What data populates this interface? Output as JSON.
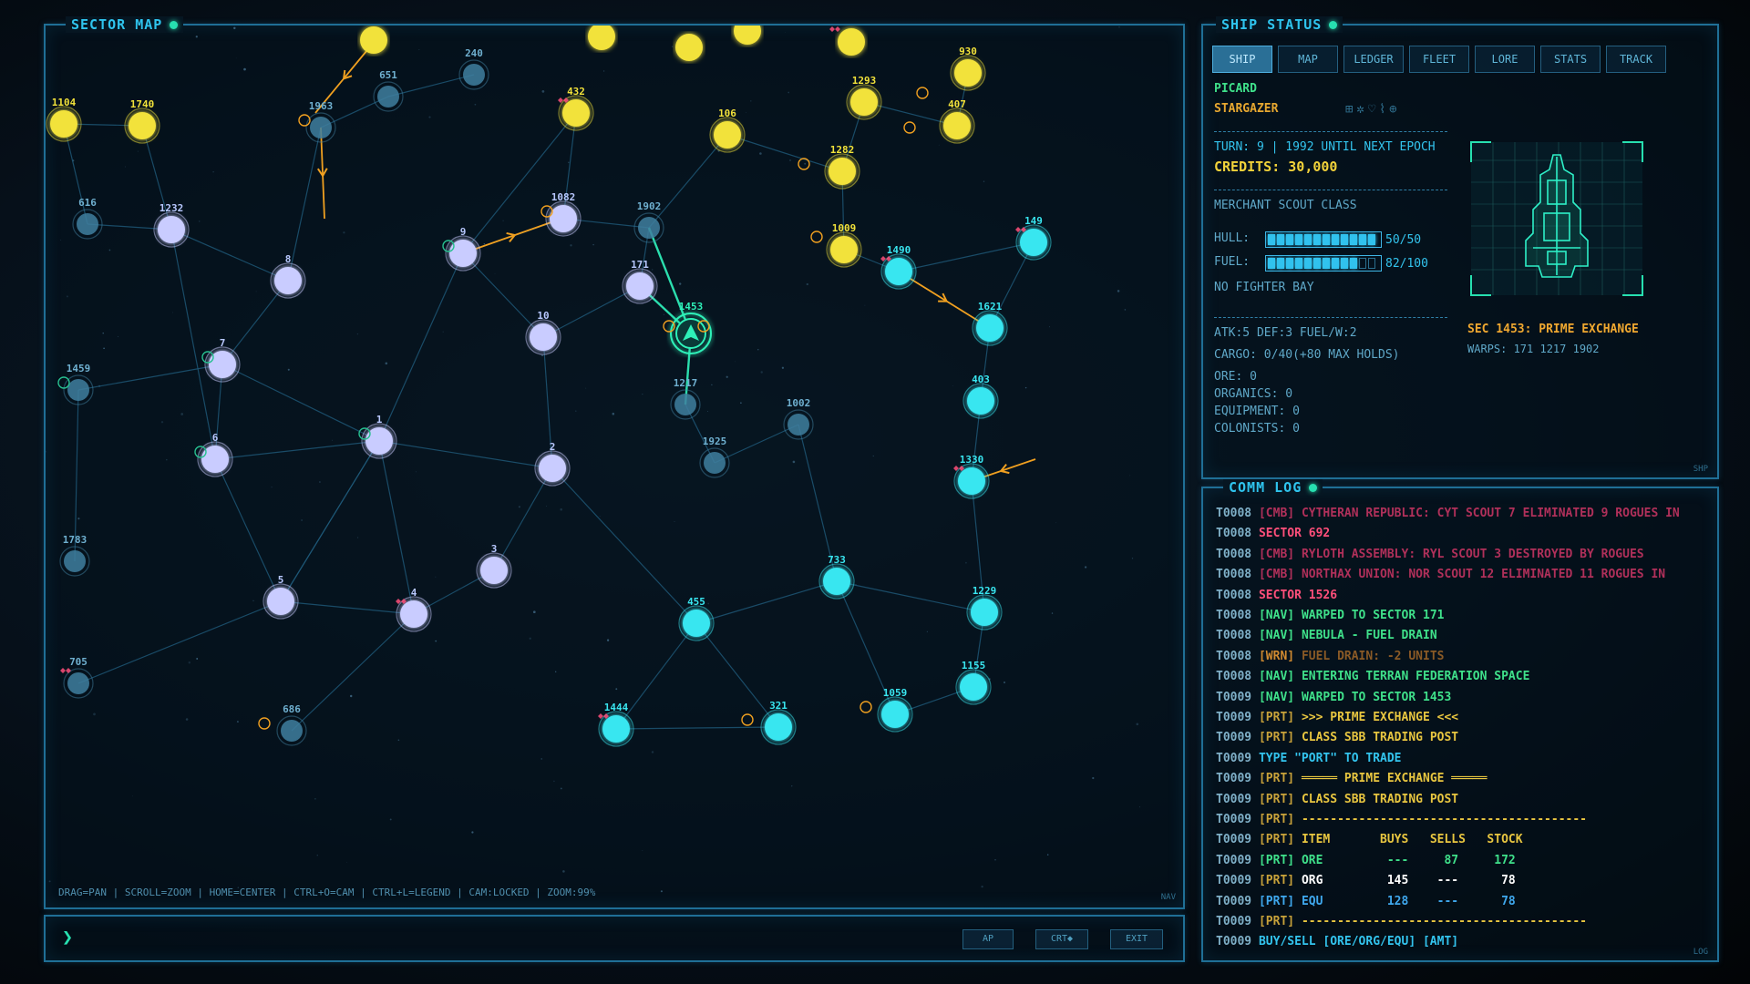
{
  "sector_map": {
    "title": "SECTOR MAP",
    "help": "DRAG=PAN | SCROLL=ZOOM | HOME=CENTER | CTRL+O=CAM | CTRL+L=LEGEND | CAM:LOCKED | ZOOM:99%",
    "corner": "NAV"
  },
  "command_bar": {
    "prompt": "❯",
    "buttons": [
      "AP",
      "CRT◆",
      "EXIT"
    ]
  },
  "ship_status": {
    "title": "SHIP STATUS",
    "tabs": [
      "SHIP",
      "MAP",
      "LEDGER",
      "FLEET",
      "LORE",
      "STATS",
      "TRACK"
    ],
    "active_tab": "SHIP",
    "captain": "PICARD",
    "ship_name": "STARGAZER",
    "turn_line": "TURN: 9 | 1992 UNTIL NEXT EPOCH",
    "credits": "CREDITS: 30,000",
    "ship_class": "MERCHANT SCOUT CLASS",
    "hull_label": "HULL:",
    "hull_value": "50/50",
    "hull_fraction": 1.0,
    "fuel_label": "FUEL:",
    "fuel_value": "82/100",
    "fuel_fraction": 0.82,
    "fighter_bay": "NO FIGHTER BAY",
    "stats_line": "ATK:5 DEF:3 FUEL/W:2",
    "cargo_line": "CARGO: 0/40(+80 MAX HOLDS)",
    "ore": "ORE: 0",
    "organics": "ORGANICS: 0",
    "equipment": "EQUIPMENT: 0",
    "colonists": "COLONISTS: 0",
    "sector_line": "SEC 1453: PRIME EXCHANGE",
    "warps_line": "WARPS: 171 1217 1902",
    "corner": "SHP"
  },
  "comm_log": {
    "title": "COMM LOG",
    "corner": "LOG",
    "lines": [
      {
        "t": "T0008",
        "parts": [
          [
            "[CMB] ",
            "#b0305a"
          ],
          [
            "CYTHERAN REPUBLIC: CYT SCOUT 7 ELIMINATED 9 ROGUES IN",
            "#b0305a"
          ]
        ]
      },
      {
        "t": "T0008",
        "parts": [
          [
            "SECTOR 692",
            "#ff4f7a"
          ]
        ]
      },
      {
        "t": "T0008",
        "parts": [
          [
            "[CMB] ",
            "#b0305a"
          ],
          [
            "RYLOTH ASSEMBLY: RYL SCOUT 3 DESTROYED BY ROGUES",
            "#b0305a"
          ]
        ]
      },
      {
        "t": "T0008",
        "parts": [
          [
            "[CMB] ",
            "#b0305a"
          ],
          [
            "NORTHAX UNION: NOR SCOUT 12 ELIMINATED 11 ROGUES IN",
            "#b0305a"
          ]
        ]
      },
      {
        "t": "T0008",
        "parts": [
          [
            "SECTOR 1526",
            "#ff4f7a"
          ]
        ]
      },
      {
        "t": "T0008",
        "parts": [
          [
            "[NAV] ",
            "#3fe08a"
          ],
          [
            "WARPED TO SECTOR 171",
            "#3fe08a"
          ]
        ]
      },
      {
        "t": "T0008",
        "parts": [
          [
            "[NAV] ",
            "#3fe08a"
          ],
          [
            "NEBULA - FUEL DRAIN",
            "#3fe08a"
          ]
        ]
      },
      {
        "t": "T0008",
        "parts": [
          [
            "[WRN] ",
            "#d08a30"
          ],
          [
            "FUEL DRAIN: -2 UNITS",
            "#8a5a26"
          ]
        ]
      },
      {
        "t": "T0008",
        "parts": [
          [
            "[NAV] ",
            "#3fe08a"
          ],
          [
            "ENTERING TERRAN FEDERATION SPACE",
            "#3fe08a"
          ]
        ]
      },
      {
        "t": "T0009",
        "parts": [
          [
            "[NAV] ",
            "#3fe08a"
          ],
          [
            "WARPED TO SECTOR 1453",
            "#3fe08a"
          ]
        ]
      },
      {
        "t": "T0009",
        "parts": [
          [
            "[PRT] ",
            "#c8a23a"
          ],
          [
            ">>> PRIME EXCHANGE <<<",
            "#e8c640"
          ]
        ]
      },
      {
        "t": "T0009",
        "parts": [
          [
            "[PRT] ",
            "#c8a23a"
          ],
          [
            "CLASS SBB TRADING POST",
            "#e8c640"
          ]
        ]
      },
      {
        "t": "T0009",
        "parts": [
          [
            "TYPE \"PORT\" TO TRADE",
            "#33c4ee"
          ]
        ]
      },
      {
        "t": "T0009",
        "parts": [
          [
            "[PRT] ",
            "#c8a23a"
          ],
          [
            "═════ PRIME EXCHANGE ═════",
            "#e8c640"
          ]
        ]
      },
      {
        "t": "T0009",
        "parts": [
          [
            "[PRT] ",
            "#c8a23a"
          ],
          [
            "CLASS SBB TRADING POST",
            "#e8c640"
          ]
        ]
      },
      {
        "t": "T0009",
        "parts": [
          [
            "[PRT] ",
            "#c8a23a"
          ],
          [
            "----------------------------------------",
            "#e8c640"
          ]
        ]
      },
      {
        "t": "T0009",
        "parts": [
          [
            "[PRT] ",
            "#c8a23a"
          ],
          [
            "ITEM       BUYS   SELLS   STOCK",
            "#e8c640"
          ]
        ]
      },
      {
        "t": "T0009",
        "parts": [
          [
            "[PRT] ",
            "#3fe08a"
          ],
          [
            "ORE         ---     87     172",
            "#3fe08a"
          ]
        ]
      },
      {
        "t": "T0009",
        "parts": [
          [
            "[PRT] ",
            "#c8a23a"
          ],
          [
            "ORG         145    ---      78",
            "#ffffff"
          ]
        ]
      },
      {
        "t": "T0009",
        "parts": [
          [
            "[PRT] ",
            "#3fa8ee"
          ],
          [
            "EQU         128    ---      78",
            "#3fa8ee"
          ]
        ]
      },
      {
        "t": "T0009",
        "parts": [
          [
            "[PRT] ",
            "#c8a23a"
          ],
          [
            "----------------------------------------",
            "#e8c640"
          ]
        ]
      },
      {
        "t": "T0009",
        "parts": [
          [
            "BUY/SELL [ORE/ORG/EQU] [AMT]",
            "#33c4ee"
          ]
        ]
      }
    ]
  },
  "colors": {
    "yellow": "#f2e23a",
    "lavender": "#c9ccff",
    "cyan": "#39e6f0",
    "steel": "#3f7f9f",
    "route": "#f0a020",
    "player": "#2ef0b8"
  },
  "nodes": [
    {
      "id": "240",
      "c": "steel"
    },
    {
      "id": "651",
      "c": "steel"
    },
    {
      "id": "1963",
      "c": "steel"
    },
    {
      "id": "1104",
      "c": "yellow"
    },
    {
      "id": "1740",
      "c": "yellow"
    },
    {
      "id": "616",
      "c": "steel"
    },
    {
      "id": "1232",
      "c": "lavender"
    },
    {
      "id": "8",
      "c": "lavender"
    },
    {
      "id": "9",
      "c": "lavender"
    },
    {
      "id": "1082",
      "c": "lavender"
    },
    {
      "id": "432",
      "c": "yellow"
    },
    {
      "id": "106",
      "c": "yellow"
    },
    {
      "id": "1902",
      "c": "steel"
    },
    {
      "id": "171",
      "c": "lavender"
    },
    {
      "id": "1453",
      "c": "player"
    },
    {
      "id": "10",
      "c": "lavender"
    },
    {
      "id": "1217",
      "c": "steel"
    },
    {
      "id": "1002",
      "c": "steel"
    },
    {
      "id": "1925",
      "c": "steel"
    },
    {
      "id": "7",
      "c": "lavender"
    },
    {
      "id": "1459",
      "c": "steel"
    },
    {
      "id": "6",
      "c": "lavender"
    },
    {
      "id": "1",
      "c": "lavender"
    },
    {
      "id": "2",
      "c": "lavender"
    },
    {
      "id": "1783",
      "c": "steel"
    },
    {
      "id": "3",
      "c": "lavender"
    },
    {
      "id": "5",
      "c": "lavender"
    },
    {
      "id": "4",
      "c": "lavender"
    },
    {
      "id": "705",
      "c": "steel"
    },
    {
      "id": "686",
      "c": "steel"
    },
    {
      "id": "1444",
      "c": "cyan"
    },
    {
      "id": "321",
      "c": "cyan"
    },
    {
      "id": "455",
      "c": "cyan"
    },
    {
      "id": "733",
      "c": "cyan"
    },
    {
      "id": "1059",
      "c": "cyan"
    },
    {
      "id": "1155",
      "c": "cyan"
    },
    {
      "id": "1229",
      "c": "cyan"
    },
    {
      "id": "1330",
      "c": "cyan"
    },
    {
      "id": "403",
      "c": "cyan"
    },
    {
      "id": "1621",
      "c": "cyan"
    },
    {
      "id": "1490",
      "c": "cyan"
    },
    {
      "id": "149",
      "c": "cyan"
    },
    {
      "id": "1009",
      "c": "yellow"
    },
    {
      "id": "1282",
      "c": "yellow"
    },
    {
      "id": "1293",
      "c": "yellow"
    },
    {
      "id": "407",
      "c": "yellow"
    },
    {
      "id": "930",
      "c": "yellow"
    }
  ]
}
